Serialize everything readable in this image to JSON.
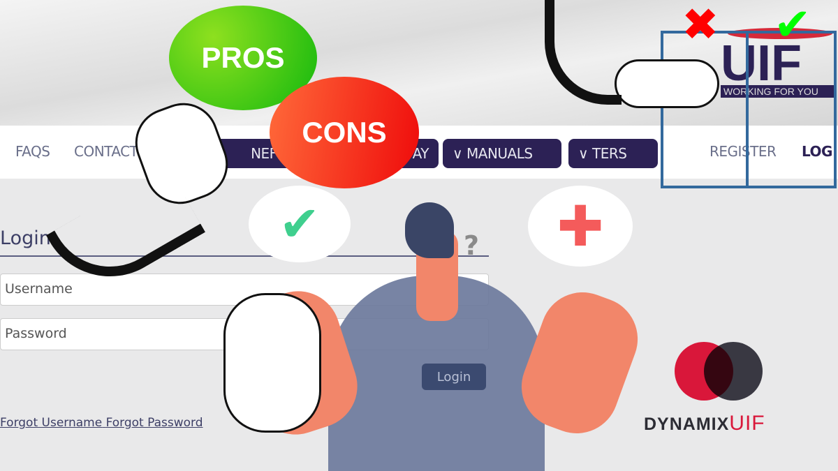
{
  "nav": {
    "links": [
      "FAQS",
      "CONTACT"
    ],
    "buttons": [
      "NEFITS",
      "AY",
      "MANUALS",
      "TERS"
    ],
    "register": "REGISTER",
    "login": "LOG"
  },
  "logo": {
    "text": "UIF",
    "tagline": "WORKING FOR YOU"
  },
  "login": {
    "title": "Login",
    "username_placeholder": "Username",
    "password_placeholder": "Password",
    "button": "Login",
    "forgot_username": "Forgot Username",
    "forgot_password": "Forgot Password"
  },
  "overlay": {
    "pros": "PROS",
    "cons": "CONS",
    "question": "?",
    "brand_a": "DYNAMIX",
    "brand_b": "UIF"
  },
  "colors": {
    "nav_button": "#2c2155",
    "pros": "#22c21a",
    "cons": "#f23d15",
    "check": "#3fcf8e",
    "cross": "#f45b5b",
    "frame": "#33699d",
    "brand_red": "#d9173a"
  }
}
